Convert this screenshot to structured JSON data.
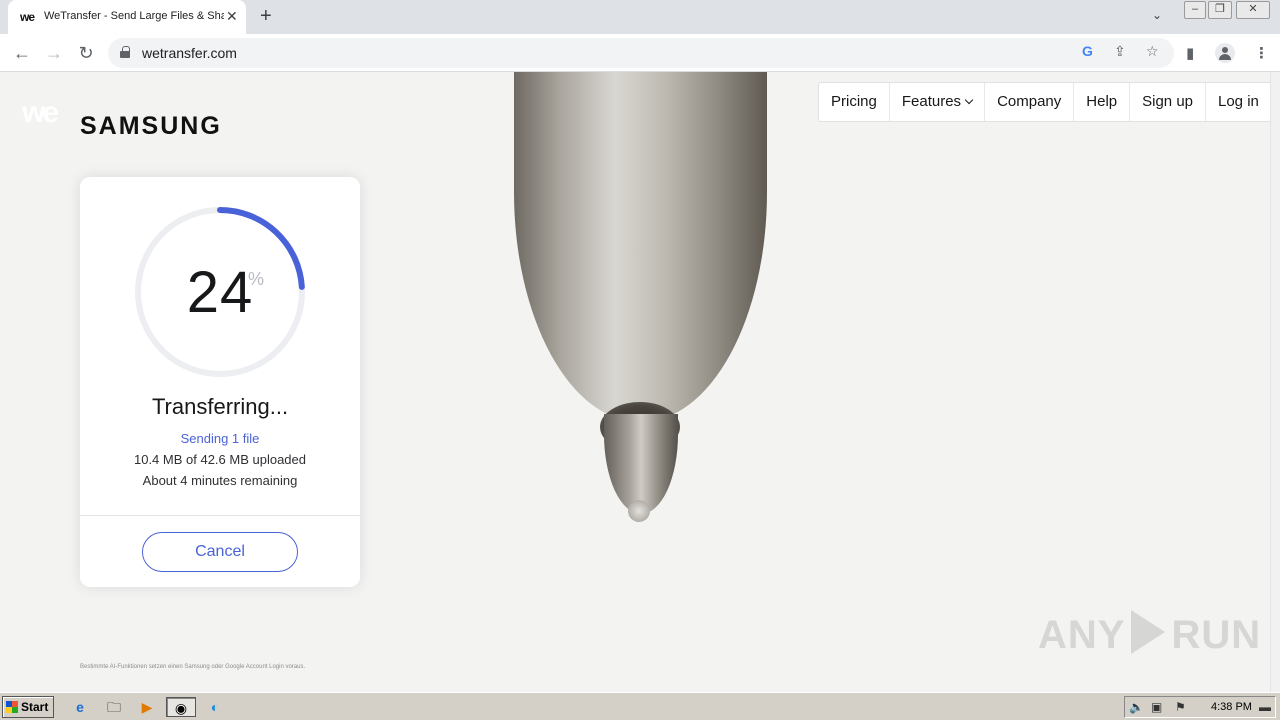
{
  "browser": {
    "tab": {
      "favicon": "we",
      "title": "WeTransfer - Send Large Files & Share Photos Online",
      "close": "✕"
    },
    "new_tab": "+",
    "url": "wetransfer.com",
    "window_controls": {
      "minimize": "–",
      "restore": "❐",
      "close": "✕"
    }
  },
  "page": {
    "logo": "we",
    "brand": "SAMSUNG",
    "nav": [
      {
        "label": "Pricing"
      },
      {
        "label": "Features"
      },
      {
        "label": "Company"
      },
      {
        "label": "Help"
      },
      {
        "label": "Sign up"
      },
      {
        "label": "Log in"
      }
    ],
    "transfer": {
      "percent_value": "24",
      "percent_sign": "%",
      "progress": 0.24,
      "progress_color": "#4a62d8",
      "track_color": "#eceef2",
      "title": "Transferring...",
      "sending": "Sending 1 file",
      "uploaded": "10.4 MB of 42.6 MB uploaded",
      "remaining": "About 4 minutes remaining",
      "cancel_label": "Cancel"
    },
    "disclaimer": "Bestimmte AI-Funktionen setzen einen Samsung oder Google Account Login voraus.",
    "watermark": {
      "left": "ANY",
      "right": "RUN"
    }
  },
  "taskbar": {
    "start_label": "Start",
    "clock": "4:38 PM",
    "apps": [
      "ie-icon",
      "explorer-icon",
      "media-player-icon",
      "chrome-icon",
      "edge-icon"
    ]
  }
}
